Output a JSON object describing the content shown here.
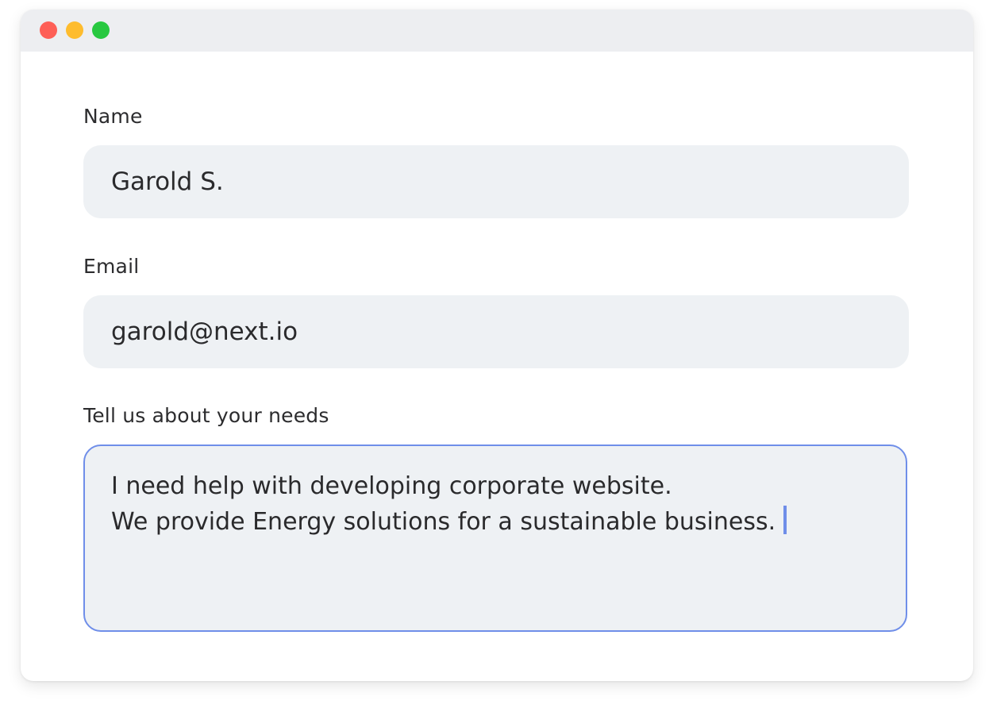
{
  "window": {
    "controls": [
      {
        "name": "close",
        "color": "#fe5f57"
      },
      {
        "name": "minimize",
        "color": "#febc2e"
      },
      {
        "name": "maximize",
        "color": "#28c840"
      }
    ]
  },
  "form": {
    "name": {
      "label": "Name",
      "value": "Garold S."
    },
    "email": {
      "label": "Email",
      "value": "garold@next.io"
    },
    "needs": {
      "label": "Tell us about your needs",
      "line1": "I need help with developing corporate website.",
      "line2": "We provide Energy solutions for a sustainable business."
    }
  },
  "colors": {
    "field_bg": "#eef1f4",
    "focus_border": "#6f8ee9",
    "titlebar_bg": "#edeef1"
  }
}
